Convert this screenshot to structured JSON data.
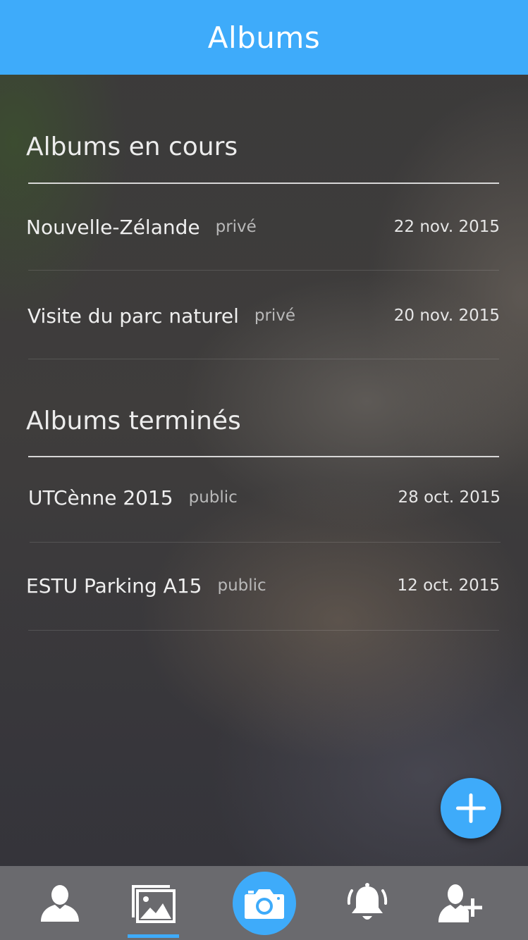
{
  "header": {
    "title": "Albums"
  },
  "sections": [
    {
      "title": "Albums en cours",
      "albums": [
        {
          "name": "Nouvelle-Zélande",
          "visibility": "privé",
          "date": "22 nov. 2015"
        },
        {
          "name": "Visite du parc naturel",
          "visibility": "privé",
          "date": "20 nov. 2015"
        }
      ]
    },
    {
      "title": "Albums terminés",
      "albums": [
        {
          "name": "UTCènne 2015",
          "visibility": "public",
          "date": "28 oct. 2015"
        },
        {
          "name": "ESTU Parking A15",
          "visibility": "public",
          "date": "12 oct. 2015"
        }
      ]
    }
  ],
  "fab": {
    "icon": "plus-icon"
  },
  "tabbar": {
    "items": [
      {
        "icon": "profile-icon",
        "active": false
      },
      {
        "icon": "albums-gallery-icon",
        "active": true
      },
      {
        "icon": "camera-icon",
        "active": false
      },
      {
        "icon": "notifications-bell-icon",
        "active": false
      },
      {
        "icon": "add-friend-icon",
        "active": false
      }
    ]
  },
  "colors": {
    "accent": "#3eabfa",
    "tabbar": "#6a6a6e"
  }
}
